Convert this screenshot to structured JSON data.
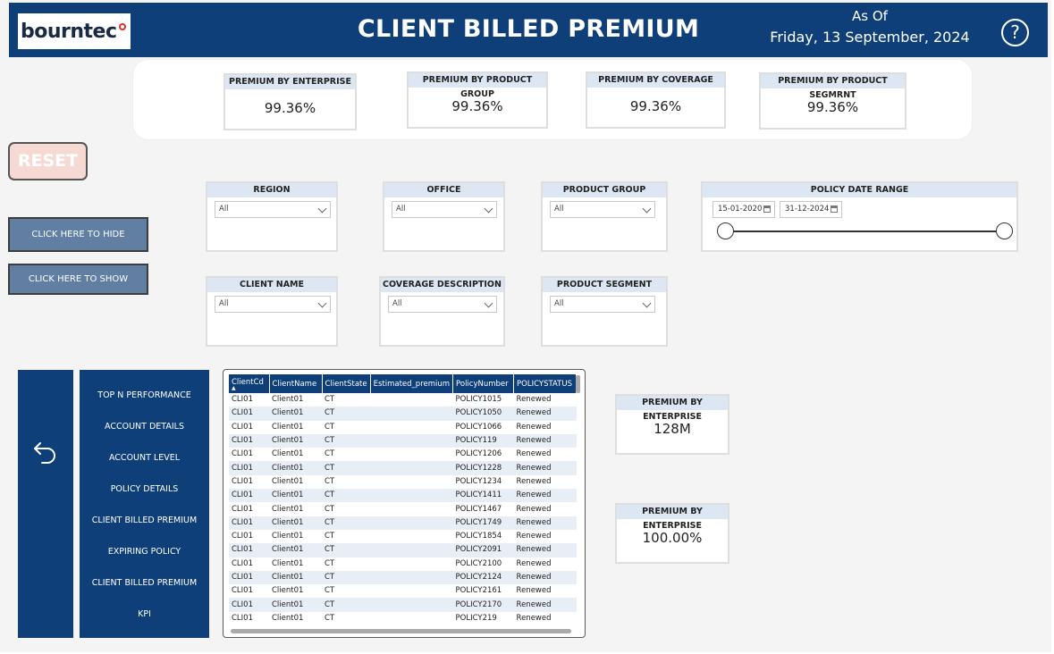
{
  "header": {
    "logo_text": "bourntec",
    "title": "CLIENT BILLED PREMIUM",
    "as_of_label": "As Of",
    "as_of_date": "Friday, 13 September, 2024",
    "help_glyph": "?"
  },
  "kpis": [
    {
      "label": "PREMIUM BY ENTERPRISE",
      "value": "99.36%"
    },
    {
      "label": "PREMIUM BY PRODUCT GROUP",
      "value": "99.36%"
    },
    {
      "label": "PREMIUM BY COVERAGE",
      "value": "99.36%"
    },
    {
      "label": "PREMIUM BY PRODUCT SEGMRNT",
      "value": "99.36%"
    }
  ],
  "buttons": {
    "reset": "RESET",
    "hide": "CLICK HERE TO HIDE",
    "show": "CLICK HERE TO SHOW"
  },
  "slicers": {
    "region": {
      "label": "REGION",
      "value": "All"
    },
    "office": {
      "label": "OFFICE",
      "value": "All"
    },
    "product_group": {
      "label": "PRODUCT GROUP",
      "value": "All"
    },
    "client_name": {
      "label": "CLIENT NAME",
      "value": "All"
    },
    "coverage_description": {
      "label": "COVERAGE DESCRIPTION",
      "value": "All"
    },
    "product_segment": {
      "label": "PRODUCT SEGMENT",
      "value": "All"
    },
    "policy_date_range": {
      "label": "POLICY DATE RANGE",
      "start": "15-01-2020",
      "end": "31-12-2024"
    }
  },
  "nav": {
    "back_icon": "back-arrow-icon",
    "items": [
      "TOP N PERFORMANCE",
      "ACCOUNT DETAILS",
      "ACCOUNT LEVEL",
      "POLICY DETAILS",
      "CLIENT BILLED PREMIUM",
      "EXPIRING POLICY",
      "CLIENT BILLED PREMIUM",
      "KPI"
    ]
  },
  "table": {
    "columns": [
      "ClientCd",
      "ClientName",
      "ClientState",
      "Estimated_premium",
      "PolicyNumber",
      "POLICYSTATUS"
    ],
    "rows": [
      [
        "CLI01",
        "Client01",
        "CT",
        "",
        "POLICY1015",
        "Renewed"
      ],
      [
        "CLI01",
        "Client01",
        "CT",
        "",
        "POLICY1050",
        "Renewed"
      ],
      [
        "CLI01",
        "Client01",
        "CT",
        "",
        "POLICY1066",
        "Renewed"
      ],
      [
        "CLI01",
        "Client01",
        "CT",
        "",
        "POLICY119",
        "Renewed"
      ],
      [
        "CLI01",
        "Client01",
        "CT",
        "",
        "POLICY1206",
        "Renewed"
      ],
      [
        "CLI01",
        "Client01",
        "CT",
        "",
        "POLICY1228",
        "Renewed"
      ],
      [
        "CLI01",
        "Client01",
        "CT",
        "",
        "POLICY1234",
        "Renewed"
      ],
      [
        "CLI01",
        "Client01",
        "CT",
        "",
        "POLICY1411",
        "Renewed"
      ],
      [
        "CLI01",
        "Client01",
        "CT",
        "",
        "POLICY1467",
        "Renewed"
      ],
      [
        "CLI01",
        "Client01",
        "CT",
        "",
        "POLICY1749",
        "Renewed"
      ],
      [
        "CLI01",
        "Client01",
        "CT",
        "",
        "POLICY1854",
        "Renewed"
      ],
      [
        "CLI01",
        "Client01",
        "CT",
        "",
        "POLICY2091",
        "Renewed"
      ],
      [
        "CLI01",
        "Client01",
        "CT",
        "",
        "POLICY2100",
        "Renewed"
      ],
      [
        "CLI01",
        "Client01",
        "CT",
        "",
        "POLICY2124",
        "Renewed"
      ],
      [
        "CLI01",
        "Client01",
        "CT",
        "",
        "POLICY2161",
        "Renewed"
      ],
      [
        "CLI01",
        "Client01",
        "CT",
        "",
        "POLICY2170",
        "Renewed"
      ],
      [
        "CLI01",
        "Client01",
        "CT",
        "",
        "POLICY219",
        "Renewed"
      ]
    ]
  },
  "cards": [
    {
      "label": "PREMIUM BY ENTERPRISE",
      "value": "128M"
    },
    {
      "label": "PREMIUM BY ENTERPRISE",
      "value": "100.00%"
    }
  ],
  "colors": {
    "brand_navy": "#0e3f78",
    "header_tint": "#dde7f3",
    "button_slate": "#607fa3",
    "reset_pink": "#f7d9d3"
  }
}
